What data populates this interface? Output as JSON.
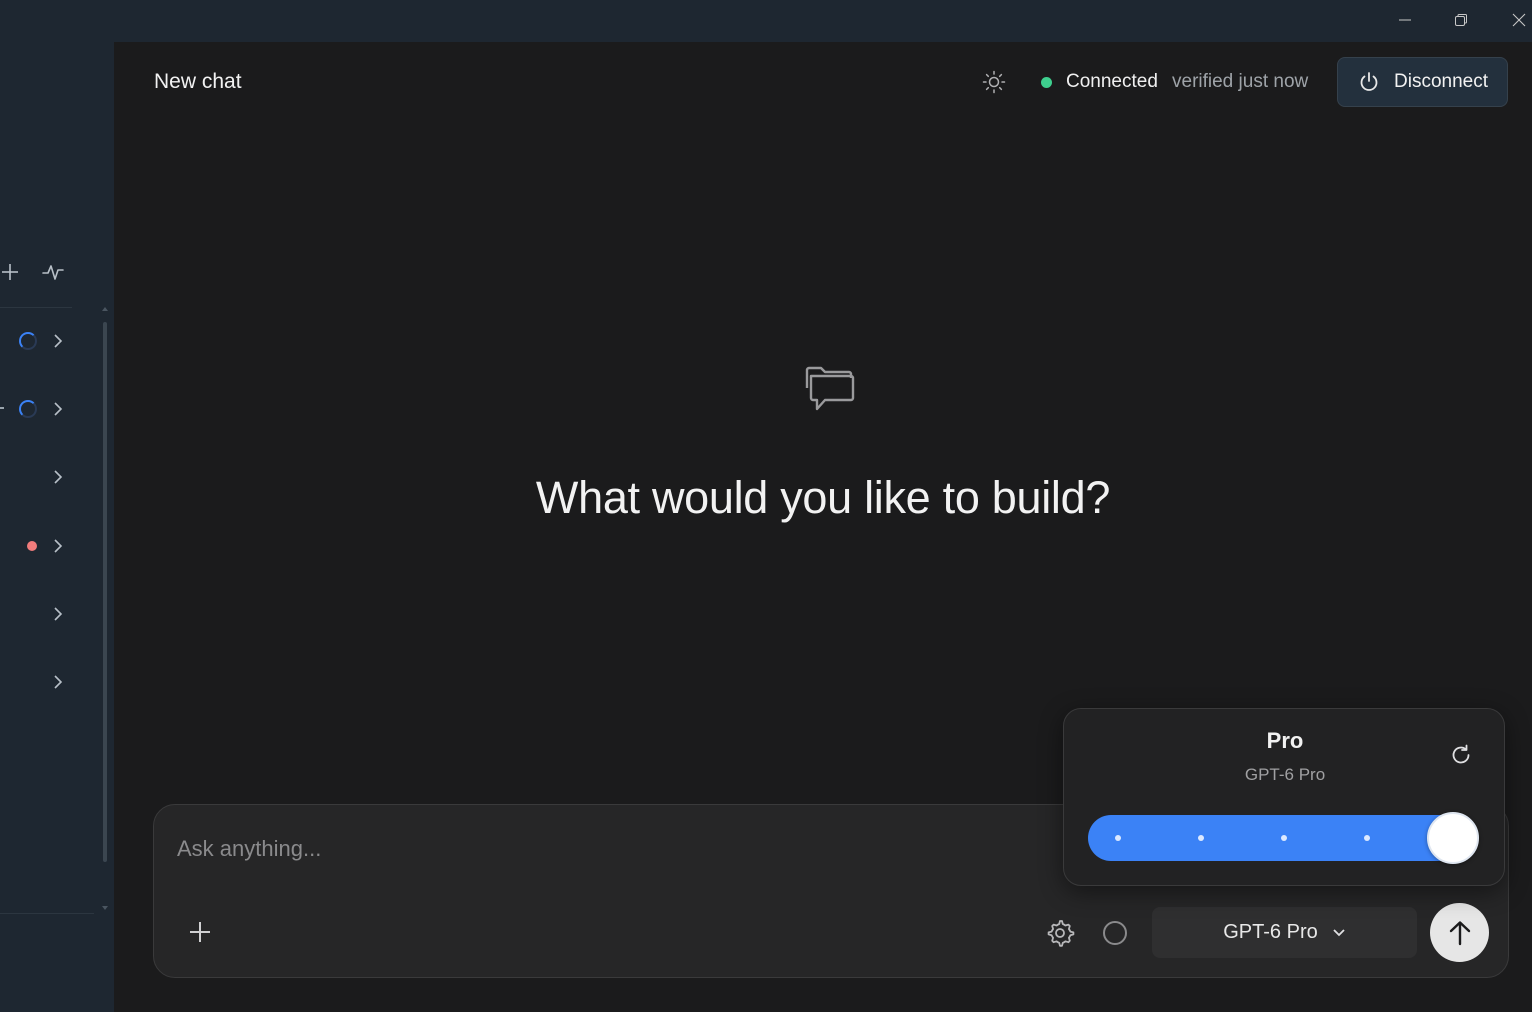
{
  "window": {
    "controls": [
      "minimize",
      "restore",
      "close"
    ]
  },
  "header": {
    "title": "New chat",
    "status": "Connected",
    "status_detail": "verified just now",
    "disconnect_label": "Disconnect"
  },
  "sidebar": {
    "items": [
      {
        "state": "loading"
      },
      {
        "state": "loading"
      },
      {
        "state": "idle"
      },
      {
        "state": "error"
      },
      {
        "state": "idle"
      },
      {
        "state": "idle"
      }
    ]
  },
  "empty_state": {
    "icon": "folder-chat-icon",
    "heading": "What would you like to build?"
  },
  "composer": {
    "placeholder": "Ask anything...",
    "model_label": "GPT-6 Pro"
  },
  "model_popover": {
    "title": "Pro",
    "subtitle": "GPT-6 Pro",
    "slider": {
      "steps": 5,
      "selected_index": 4,
      "level_fraction": 1.0
    }
  },
  "colors": {
    "accent": "#3b82f6",
    "connected": "#3ecf8e",
    "error_dot": "#f17c7c",
    "sidebar_bg": "#1e2731",
    "main_bg": "#1b1b1c"
  }
}
